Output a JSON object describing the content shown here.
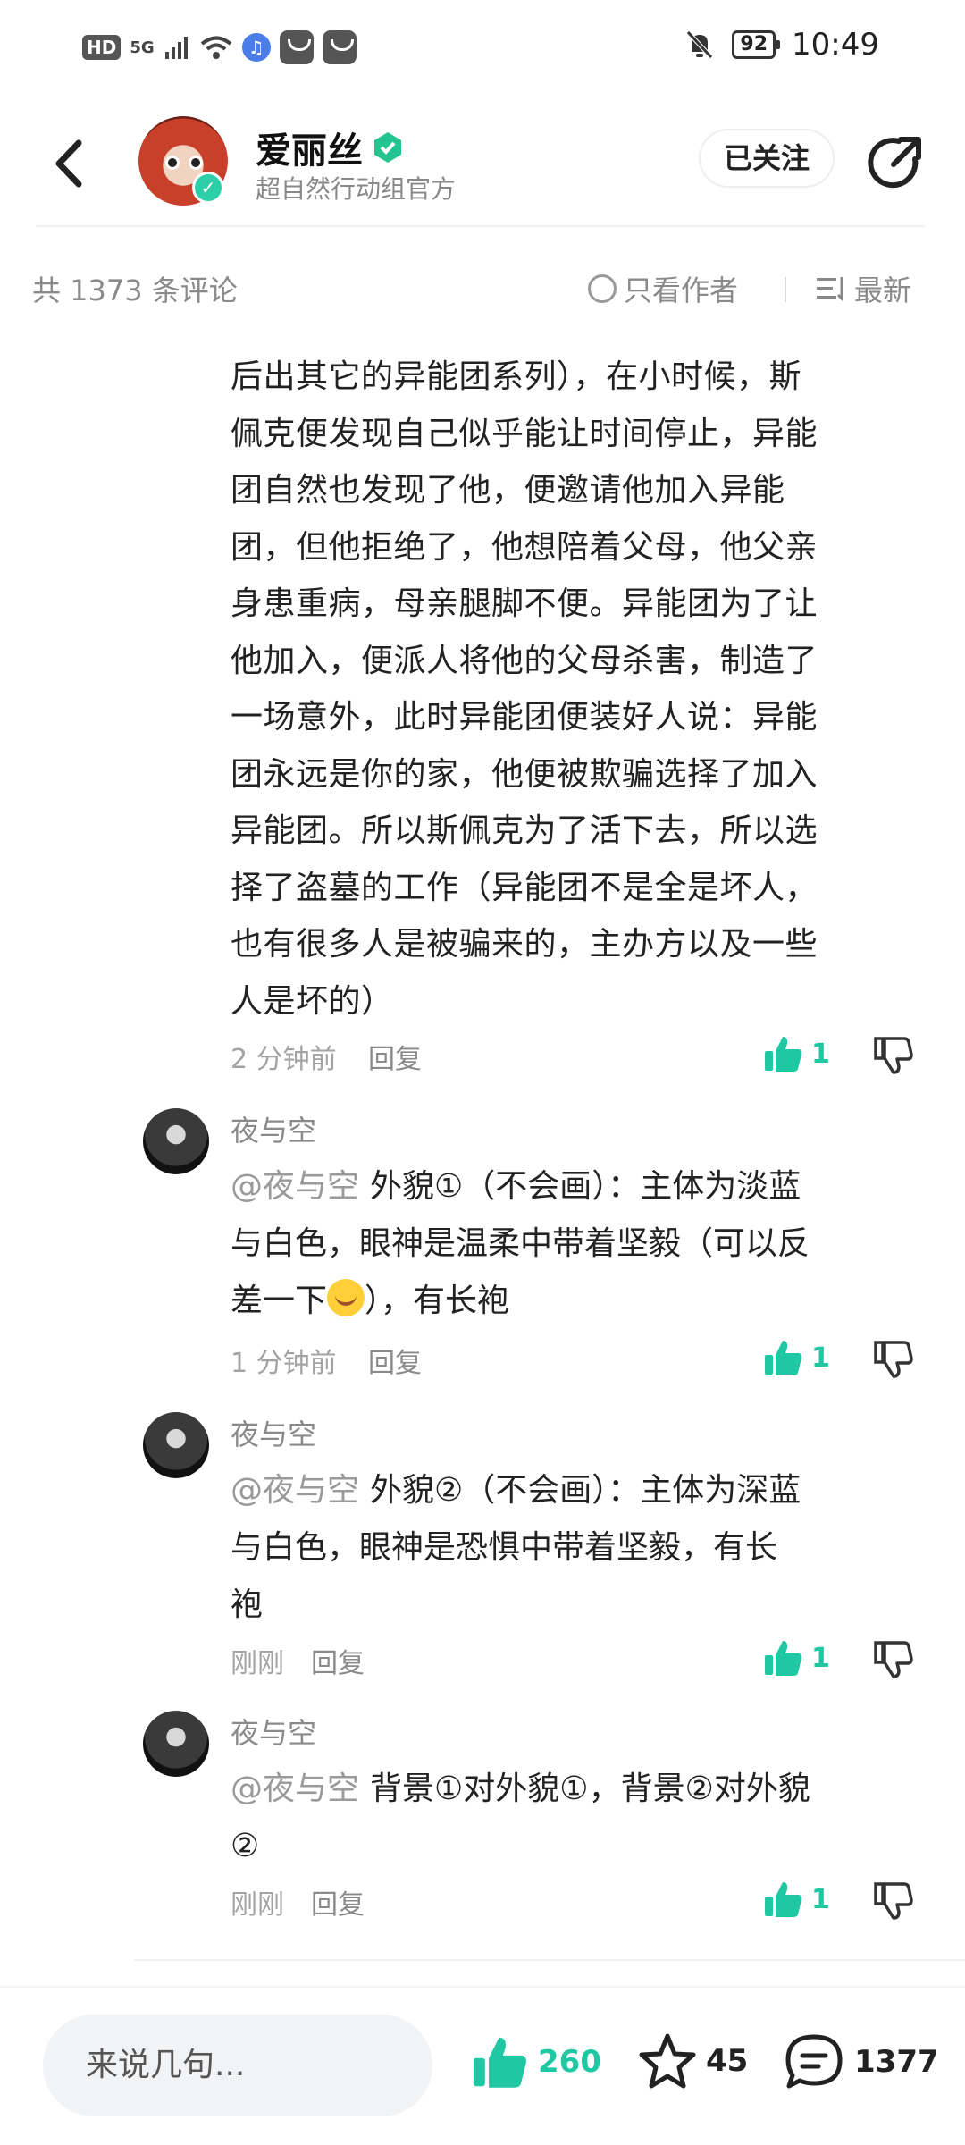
{
  "status_bar": {
    "hd": "HD",
    "network": "5G",
    "battery": "92",
    "time": "10:49",
    "icons": [
      "signal-icon",
      "wifi-icon",
      "music-icon",
      "app-icon",
      "app-icon",
      "mute-bell-icon"
    ]
  },
  "header": {
    "name": "爱丽丝",
    "subtitle": "超自然行动组官方",
    "follow_label": "已关注"
  },
  "comments_meta": {
    "count_label": "共 1373 条评论",
    "only_author_label": "只看作者",
    "sort_label": "最新"
  },
  "main_comment": {
    "lines": [
      "后出其它的异能团系列），在小时候，斯",
      "佩克便发现自己似乎能让时间停止，异能",
      "团自然也发现了他，便邀请他加入异能",
      "团，但他拒绝了，他想陪着父母，他父亲",
      "身患重病，母亲腿脚不便。异能团为了让",
      "他加入，便派人将他的父母杀害，制造了",
      "一场意外，此时异能团便装好人说：异能",
      "团永远是你的家，他便被欺骗选择了加入",
      "异能团。所以斯佩克为了活下去，所以选",
      "择了盗墓的工作（异能团不是全是坏人，",
      "也有很多人是被骗来的，主办方以及一些",
      "人是坏的）"
    ],
    "time": "2 分钟前",
    "reply_label": "回复",
    "likes": "1"
  },
  "replies": [
    {
      "user": "夜与空",
      "mention": "@夜与空",
      "line1": "外貌①（不会画）：主体为淡蓝",
      "line2": "与白色，眼神是温柔中带着坚毅（可以反",
      "line3_a": "差一下",
      "line3_b": "），有长袍",
      "time": "1 分钟前",
      "reply_label": "回复",
      "likes": "1"
    },
    {
      "user": "夜与空",
      "mention": "@夜与空",
      "line1": "外貌②（不会画）：主体为深蓝",
      "line2": "与白色，眼神是恐惧中带着坚毅，有长",
      "line3": "袍",
      "time": "刚刚",
      "reply_label": "回复",
      "likes": "1"
    },
    {
      "user": "夜与空",
      "mention": "@夜与空",
      "line1": "背景①对外貌①，背景②对外貌",
      "line2": "②",
      "time": "刚刚",
      "reply_label": "回复",
      "likes": "1"
    }
  ],
  "bottom_bar": {
    "input_placeholder": "来说几句...",
    "likes": "260",
    "stars": "45",
    "comments": "1377"
  },
  "colors": {
    "accent": "#1fc7a3",
    "muted": "#8a8a8a"
  }
}
